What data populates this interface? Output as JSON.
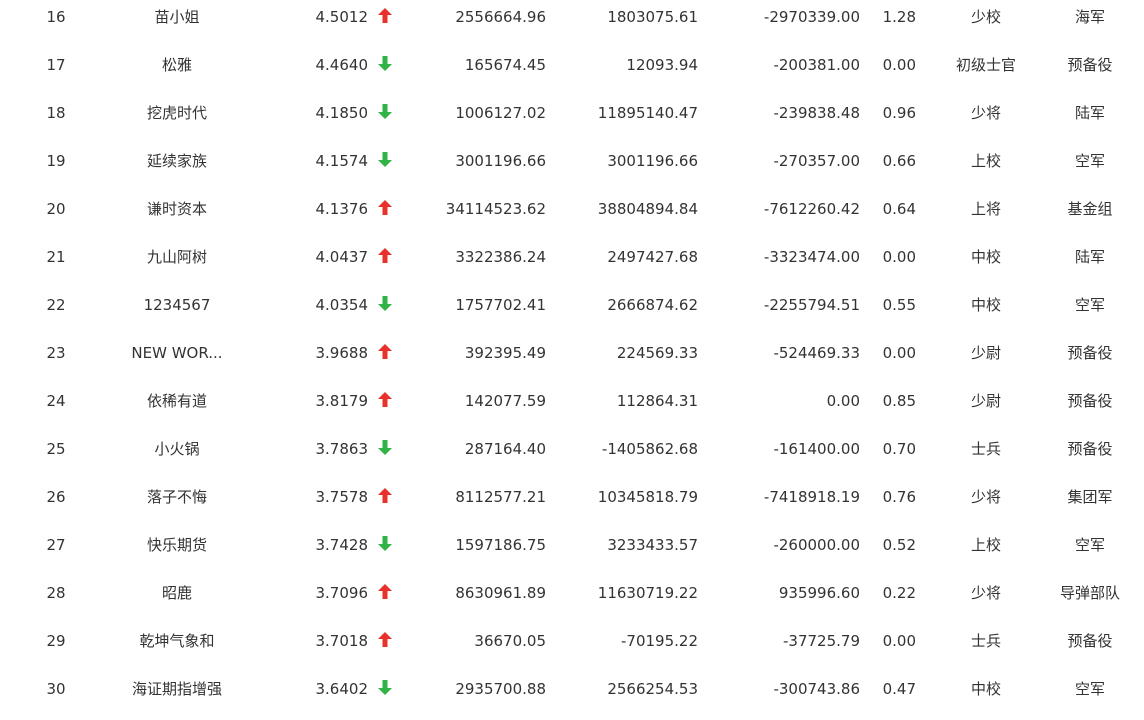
{
  "colors": {
    "up": "#e8312a",
    "down": "#2fb344",
    "text": "#333333"
  },
  "rows": [
    {
      "rank": "16",
      "name": "苗小姐",
      "score": "4.5012",
      "trend": "up",
      "trend_icon": "arrow-up-icon",
      "v1": "2556664.96",
      "v2": "1803075.61",
      "v3": "-2970339.00",
      "ratio": "1.28",
      "title": "少校",
      "army": "海军"
    },
    {
      "rank": "17",
      "name": "松雅",
      "score": "4.4640",
      "trend": "down",
      "trend_icon": "arrow-down-icon",
      "v1": "165674.45",
      "v2": "12093.94",
      "v3": "-200381.00",
      "ratio": "0.00",
      "title": "初级士官",
      "army": "预备役"
    },
    {
      "rank": "18",
      "name": "挖虎时代",
      "score": "4.1850",
      "trend": "down",
      "trend_icon": "arrow-down-icon",
      "v1": "1006127.02",
      "v2": "11895140.47",
      "v3": "-239838.48",
      "ratio": "0.96",
      "title": "少将",
      "army": "陆军"
    },
    {
      "rank": "19",
      "name": "延续家族",
      "score": "4.1574",
      "trend": "down",
      "trend_icon": "arrow-down-icon",
      "v1": "3001196.66",
      "v2": "3001196.66",
      "v3": "-270357.00",
      "ratio": "0.66",
      "title": "上校",
      "army": "空军"
    },
    {
      "rank": "20",
      "name": "谦时资本",
      "score": "4.1376",
      "trend": "up",
      "trend_icon": "arrow-up-icon",
      "v1": "34114523.62",
      "v2": "38804894.84",
      "v3": "-7612260.42",
      "ratio": "0.64",
      "title": "上将",
      "army": "基金组"
    },
    {
      "rank": "21",
      "name": "九山阿树",
      "score": "4.0437",
      "trend": "up",
      "trend_icon": "arrow-up-icon",
      "v1": "3322386.24",
      "v2": "2497427.68",
      "v3": "-3323474.00",
      "ratio": "0.00",
      "title": "中校",
      "army": "陆军"
    },
    {
      "rank": "22",
      "name": "1234567",
      "score": "4.0354",
      "trend": "down",
      "trend_icon": "arrow-down-icon",
      "v1": "1757702.41",
      "v2": "2666874.62",
      "v3": "-2255794.51",
      "ratio": "0.55",
      "title": "中校",
      "army": "空军"
    },
    {
      "rank": "23",
      "name": "NEW WOR...",
      "score": "3.9688",
      "trend": "up",
      "trend_icon": "arrow-up-icon",
      "v1": "392395.49",
      "v2": "224569.33",
      "v3": "-524469.33",
      "ratio": "0.00",
      "title": "少尉",
      "army": "预备役"
    },
    {
      "rank": "24",
      "name": "依稀有道",
      "score": "3.8179",
      "trend": "up",
      "trend_icon": "arrow-up-icon",
      "v1": "142077.59",
      "v2": "112864.31",
      "v3": "0.00",
      "ratio": "0.85",
      "title": "少尉",
      "army": "预备役"
    },
    {
      "rank": "25",
      "name": "小火锅",
      "score": "3.7863",
      "trend": "down",
      "trend_icon": "arrow-down-icon",
      "v1": "287164.40",
      "v2": "-1405862.68",
      "v3": "-161400.00",
      "ratio": "0.70",
      "title": "士兵",
      "army": "预备役"
    },
    {
      "rank": "26",
      "name": "落子不悔",
      "score": "3.7578",
      "trend": "up",
      "trend_icon": "arrow-up-icon",
      "v1": "8112577.21",
      "v2": "10345818.79",
      "v3": "-7418918.19",
      "ratio": "0.76",
      "title": "少将",
      "army": "集团军"
    },
    {
      "rank": "27",
      "name": "快乐期货",
      "score": "3.7428",
      "trend": "down",
      "trend_icon": "arrow-down-icon",
      "v1": "1597186.75",
      "v2": "3233433.57",
      "v3": "-260000.00",
      "ratio": "0.52",
      "title": "上校",
      "army": "空军"
    },
    {
      "rank": "28",
      "name": "昭鹿",
      "score": "3.7096",
      "trend": "up",
      "trend_icon": "arrow-up-icon",
      "v1": "8630961.89",
      "v2": "11630719.22",
      "v3": "935996.60",
      "ratio": "0.22",
      "title": "少将",
      "army": "导弹部队"
    },
    {
      "rank": "29",
      "name": "乾坤气象和",
      "score": "3.7018",
      "trend": "up",
      "trend_icon": "arrow-up-icon",
      "v1": "36670.05",
      "v2": "-70195.22",
      "v3": "-37725.79",
      "ratio": "0.00",
      "title": "士兵",
      "army": "预备役"
    },
    {
      "rank": "30",
      "name": "海证期指增强",
      "score": "3.6402",
      "trend": "down",
      "trend_icon": "arrow-down-icon",
      "v1": "2935700.88",
      "v2": "2566254.53",
      "v3": "-300743.86",
      "ratio": "0.47",
      "title": "中校",
      "army": "空军"
    }
  ]
}
